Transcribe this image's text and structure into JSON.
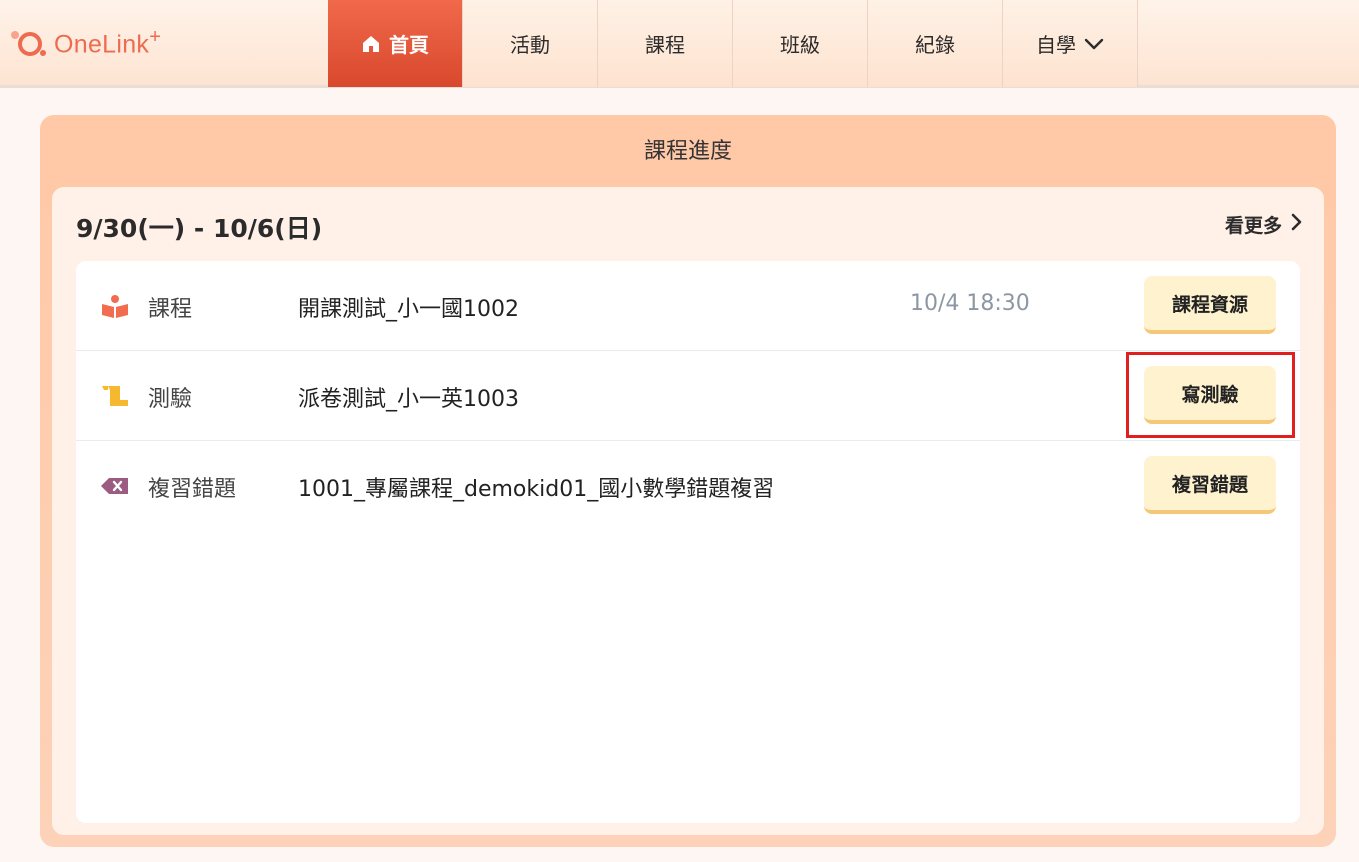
{
  "brand": {
    "name": "OneLink",
    "plus": "+",
    "color": "#ee6b50"
  },
  "nav": {
    "items": [
      {
        "label": "首頁",
        "icon": "home-icon",
        "active": true
      },
      {
        "label": "活動"
      },
      {
        "label": "課程"
      },
      {
        "label": "班級"
      },
      {
        "label": "紀錄"
      },
      {
        "label": "自學",
        "icon": "chevron-down-icon"
      }
    ]
  },
  "card": {
    "title": "課程進度",
    "week_range": "9/30(一) - 10/6(日)",
    "more_label": "看更多",
    "rows": [
      {
        "icon": "reading-icon",
        "icon_color": "#f26d4f",
        "category": "課程",
        "title": "開課測試_小一國1002",
        "time": "10/4 18:30",
        "button": "課程資源"
      },
      {
        "icon": "scroll-icon",
        "icon_color": "#f5b82e",
        "category": "測驗",
        "title": "派卷測試_小一英1003",
        "time": "",
        "button": "寫測驗"
      },
      {
        "icon": "backspace-icon",
        "icon_color": "#9c5b80",
        "category": "複習錯題",
        "title": "1001_專屬課程_demokid01_國小數學錯題複習",
        "time": "",
        "button": "複習錯題"
      }
    ]
  },
  "colors": {
    "active_nav": "#e4573a",
    "card_header": "#ffc9a8",
    "button_bg": "#fff3cf",
    "highlight": "#e02020"
  }
}
